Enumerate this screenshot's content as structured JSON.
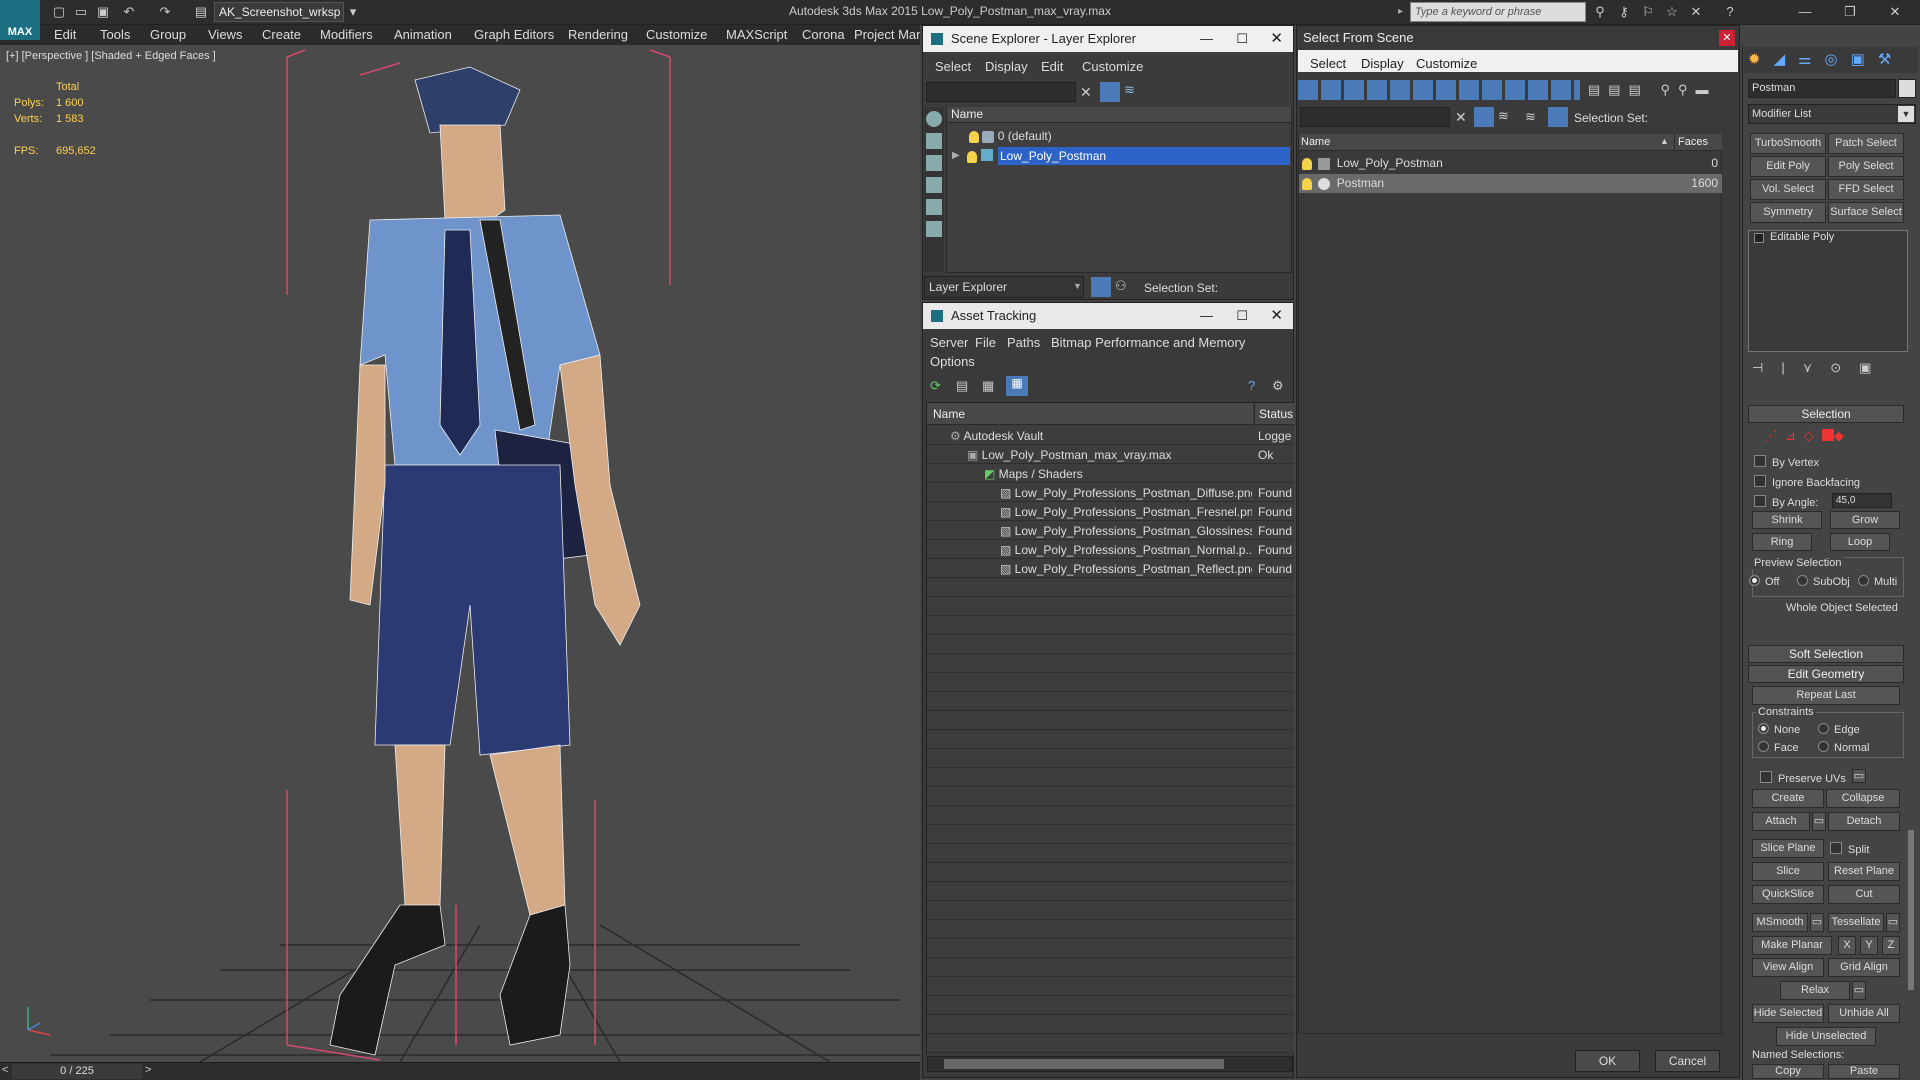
{
  "app": {
    "logo": "MAX",
    "workspace": "AK_Screenshot_wrksp",
    "title": "Autodesk 3ds Max  2015    Low_Poly_Postman_max_vray.max",
    "search_placeholder": "Type a keyword or phrase"
  },
  "menubar": [
    "Edit",
    "Tools",
    "Group",
    "Views",
    "Create",
    "Modifiers",
    "Animation",
    "Graph Editors",
    "Rendering",
    "Customize",
    "MAXScript",
    "Corona",
    "Project Man"
  ],
  "viewport": {
    "label": "[+] [Perspective ] [Shaded + Edged Faces ]",
    "total_label": "Total",
    "polys_label": "Polys:",
    "polys": "1 600",
    "verts_label": "Verts:",
    "verts": "1 583",
    "fps_label": "FPS:",
    "fps": "695,652"
  },
  "timeline": {
    "frame": "0 / 225"
  },
  "scene_explorer": {
    "title": "Scene Explorer - Layer Explorer",
    "menu": [
      "Select",
      "Display",
      "Edit",
      "Customize"
    ],
    "column": "Name",
    "rows": [
      "0 (default)",
      "Low_Poly_Postman"
    ],
    "footer_dropdown": "Layer Explorer",
    "selection_set": "Selection Set:"
  },
  "asset_tracking": {
    "title": "Asset Tracking",
    "menu": [
      "Server",
      "File",
      "Paths",
      "Bitmap Performance and Memory",
      "Options"
    ],
    "columns": [
      "Name",
      "Status"
    ],
    "rows": [
      {
        "name": "Autodesk Vault",
        "status": "Logge"
      },
      {
        "name": "Low_Poly_Postman_max_vray.max",
        "status": "Ok"
      },
      {
        "name": "Maps / Shaders",
        "status": ""
      },
      {
        "name": "Low_Poly_Professions_Postman_Diffuse.png",
        "status": "Found"
      },
      {
        "name": "Low_Poly_Professions_Postman_Fresnel.png",
        "status": "Found"
      },
      {
        "name": "Low_Poly_Professions_Postman_Glossiness...",
        "status": "Found"
      },
      {
        "name": "Low_Poly_Professions_Postman_Normal.p...",
        "status": "Found"
      },
      {
        "name": "Low_Poly_Professions_Postman_Reflect.png",
        "status": "Found"
      }
    ]
  },
  "select_from_scene": {
    "title": "Select From Scene",
    "menu": [
      "Select",
      "Display",
      "Customize"
    ],
    "selection_set": "Selection Set:",
    "columns": [
      "Name",
      "Faces"
    ],
    "rows": [
      {
        "name": "Low_Poly_Postman",
        "faces": "0"
      },
      {
        "name": "Postman",
        "faces": "1600"
      }
    ],
    "ok": "OK",
    "cancel": "Cancel"
  },
  "command_panel": {
    "object_name": "Postman",
    "modifier_list": "Modifier List",
    "modifier_buttons": [
      "TurboSmooth",
      "Patch Select",
      "Edit Poly",
      "Poly Select",
      "Vol. Select",
      "FFD Select",
      "Symmetry",
      "Surface Select"
    ],
    "stack_item": "Editable Poly",
    "selection_rollout": "Selection",
    "by_vertex": "By Vertex",
    "ignore_backfacing": "Ignore Backfacing",
    "by_angle": "By Angle:",
    "angle_value": "45,0",
    "shrink": "Shrink",
    "grow": "Grow",
    "ring": "Ring",
    "loop": "Loop",
    "preview_selection": "Preview Selection",
    "preview_options": [
      "Off",
      "SubObj",
      "Multi"
    ],
    "whole_object": "Whole Object Selected",
    "soft_selection": "Soft Selection",
    "edit_geometry": "Edit Geometry",
    "repeat_last": "Repeat Last",
    "constraints": "Constraints",
    "constraint_options": [
      "None",
      "Edge",
      "Face",
      "Normal"
    ],
    "preserve_uvs": "Preserve UVs",
    "create": "Create",
    "collapse": "Collapse",
    "attach": "Attach",
    "detach": "Detach",
    "slice_plane": "Slice Plane",
    "split": "Split",
    "slice": "Slice",
    "reset_plane": "Reset Plane",
    "quickslice": "QuickSlice",
    "cut": "Cut",
    "msmooth": "MSmooth",
    "tessellate": "Tessellate",
    "make_planar": "Make Planar",
    "x": "X",
    "y": "Y",
    "z": "Z",
    "view_align": "View Align",
    "grid_align": "Grid Align",
    "relax": "Relax",
    "hide_selected": "Hide Selected",
    "unhide_all": "Unhide All",
    "hide_unselected": "Hide Unselected",
    "named_selections": "Named Selections:",
    "copy": "Copy",
    "paste": "Paste"
  }
}
